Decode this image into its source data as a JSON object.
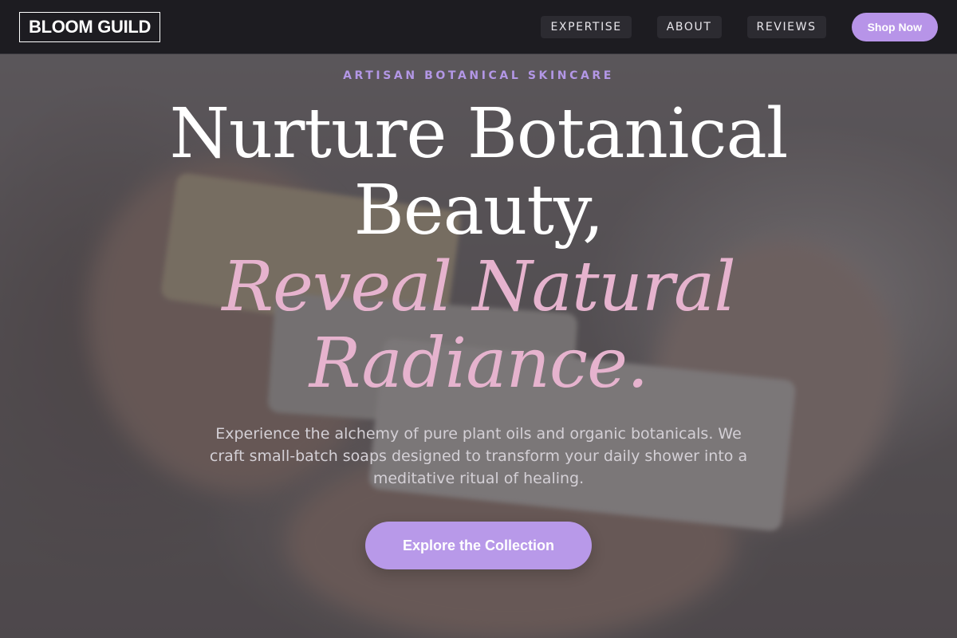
{
  "brand": {
    "name": "BLOOM GUILD"
  },
  "nav": {
    "links": [
      {
        "label": "EXPERTISE"
      },
      {
        "label": "ABOUT"
      },
      {
        "label": "REVIEWS"
      }
    ],
    "cta_label": "Shop Now"
  },
  "hero": {
    "eyebrow": "ARTISAN BOTANICAL SKINCARE",
    "headline_line1": "Nurture Botanical",
    "headline_line2": "Beauty,",
    "headline_accent_line1": "Reveal Natural",
    "headline_accent_line2": "Radiance.",
    "subtext": "Experience the alchemy of pure plant oils and organic botanicals. We craft small-batch soaps designed to transform your daily shower into a meditative ritual of healing.",
    "cta_label": "Explore the Collection",
    "background_image": "hands-holding-soap-bars-photo"
  },
  "colors": {
    "nav_background": "#1d1c21",
    "accent_purple": "#b899e9",
    "accent_pink": "#e6b3ce",
    "eyebrow_purple": "#b397e6"
  }
}
